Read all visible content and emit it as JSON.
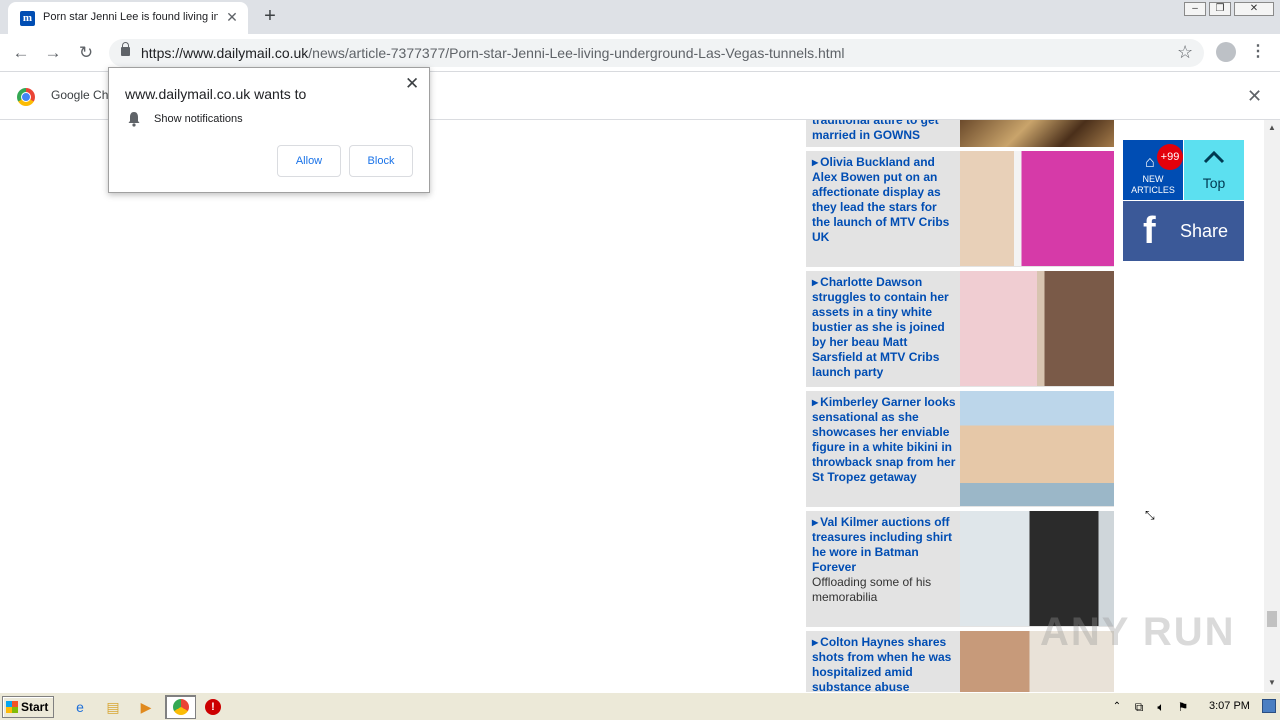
{
  "browser": {
    "tab_title": "Porn star Jenni Lee is found living in",
    "tab_favicon": "m",
    "url_domain": "https://www.dailymail.co.uk",
    "url_path": "/news/article-7377377/Porn-star-Jenni-Lee-living-underground-Las-Vegas-tunnels.html",
    "infobar_text": "Google Ch"
  },
  "notification_prompt": {
    "title": "www.dailymail.co.uk wants to",
    "permission": "Show notifications",
    "allow_label": "Allow",
    "block_label": "Block"
  },
  "articles": {
    "partial": {
      "headline": "traditional attire to get married in GOWNS"
    },
    "items": [
      {
        "headline": "Olivia Buckland and Alex Bowen put on an affectionate display as they lead the stars for the launch of MTV Cribs UK",
        "subtext": ""
      },
      {
        "headline": "Charlotte Dawson struggles to contain her assets in a tiny white bustier as she is joined by her beau Matt Sarsfield at MTV Cribs launch party",
        "subtext": ""
      },
      {
        "headline": "Kimberley Garner looks sensational as she showcases her enviable figure in a white bikini in throwback snap from her St Tropez getaway",
        "subtext": ""
      },
      {
        "headline": "Val Kilmer auctions off treasures including shirt he wore in Batman Forever",
        "subtext": "Offloading some of his memorabilia"
      },
      {
        "headline": "Colton Haynes shares shots from when he was hospitalized amid substance abuse",
        "subtext": ""
      }
    ]
  },
  "widgets": {
    "new_articles_badge": "+99",
    "new_articles_label": "NEW ARTICLES",
    "top_label": "Top",
    "share_label": "Share",
    "share_icon": "f"
  },
  "watermark": "ANY RUN",
  "taskbar": {
    "start_label": "Start",
    "clock": "3:07 PM"
  },
  "colors": {
    "dm_blue": "#004db3",
    "top_cyan": "#5ce0f0",
    "facebook": "#3b5998",
    "badge_red": "#e3000b"
  }
}
